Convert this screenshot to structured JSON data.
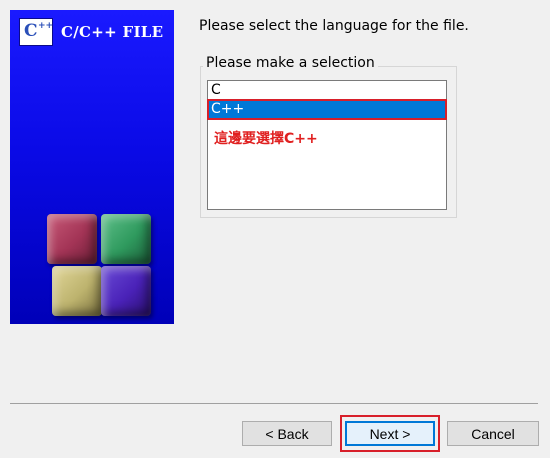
{
  "banner": {
    "logo_letter": "C",
    "logo_plus": "++",
    "title": "C/C++ FILE"
  },
  "prompt": "Please select the language for the file.",
  "group": {
    "label": "Please make a selection",
    "items": [
      "C",
      "C++"
    ],
    "selected": "C++"
  },
  "annotation": "這邊要選擇C++",
  "buttons": {
    "back": "< Back",
    "next": "Next >",
    "cancel": "Cancel"
  },
  "colors": {
    "selection": "#0078d7",
    "annotation": "#d81f2a",
    "banner": "#0a0ae6"
  }
}
